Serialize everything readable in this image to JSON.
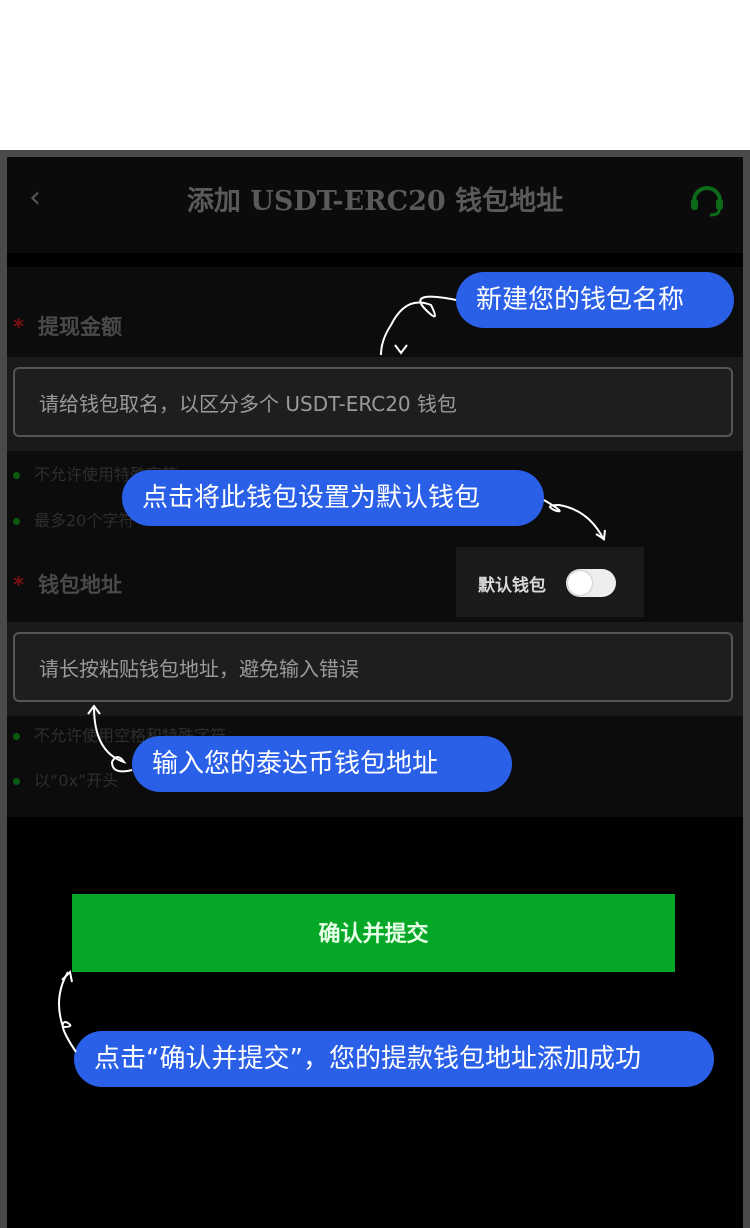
{
  "header": {
    "back_label": "‹",
    "title": "添加 USDT-ERC20 钱包地址",
    "support_icon": "headset-icon",
    "accent": "#16a626"
  },
  "form": {
    "amount_label": "提现金额",
    "name_placeholder": "请给钱包取名，以区分多个 USDT-ERC20 钱包",
    "name_hints": [
      "不允许使用特殊字符",
      "最多20个字符"
    ],
    "address_label": "钱包地址",
    "default_wallet_label": "默认钱包",
    "address_placeholder": "请长按粘贴钱包地址，避免输入错误",
    "address_hints": [
      "不允许使用空格和特殊字符",
      "以“0x”开头"
    ]
  },
  "submit_label": "确认并提交",
  "tips": {
    "name": "新建您的钱包名称",
    "default": "点击将此钱包设置为默认钱包",
    "address": "输入您的泰达币钱包地址",
    "submit": "点击“确认并提交”，您的提款钱包地址添加成功"
  },
  "colors": {
    "bubble": "#2a5fe8",
    "button": "#04a826",
    "required": "#7a1212"
  }
}
